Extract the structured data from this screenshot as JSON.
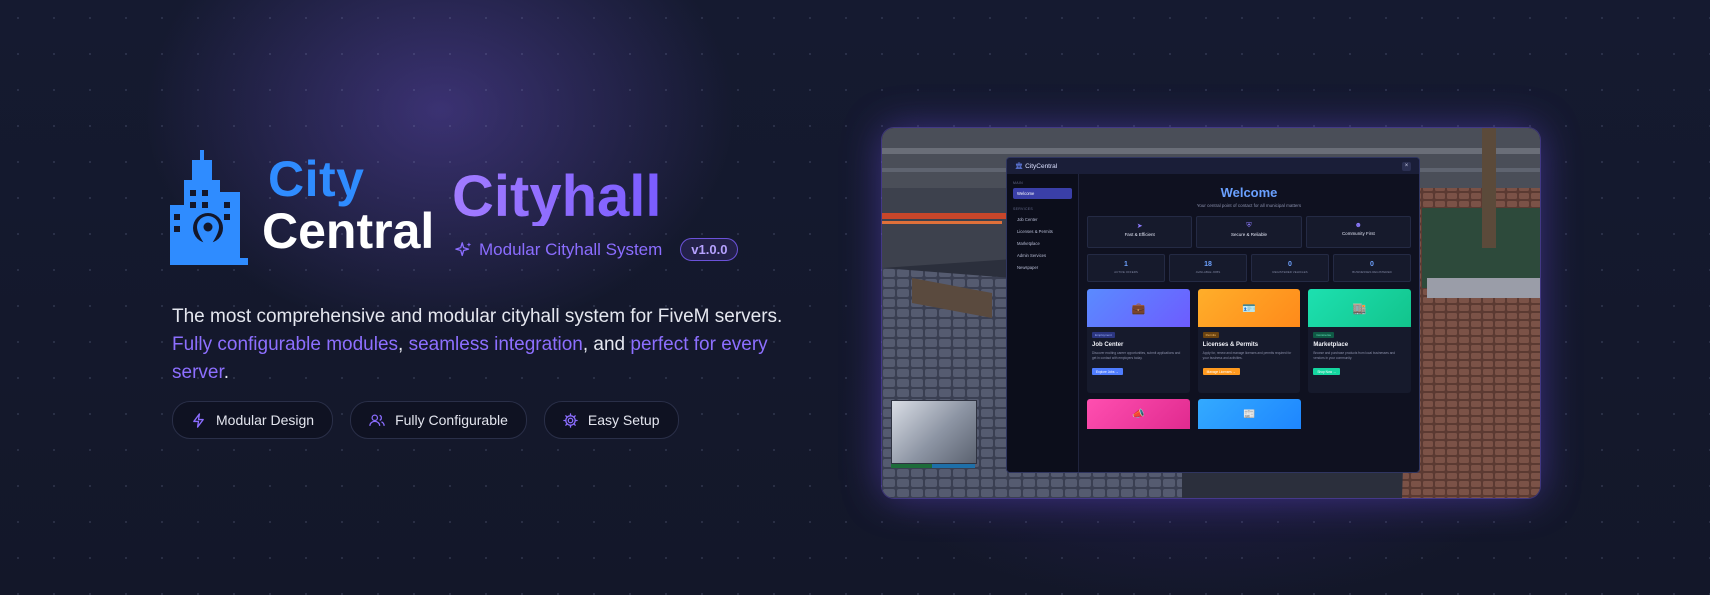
{
  "brand": {
    "logo_city": "City",
    "logo_central": "Central",
    "title": "Cityhall",
    "subtitle": "Modular Cityhall System",
    "version": "v1.0.0",
    "colors": {
      "accent_blue": "#2f8cff",
      "accent_purple": "#8b6dff",
      "background": "#13172b"
    }
  },
  "description": {
    "line_plain_1": "The most comprehensive and modular cityhall system for FiveM servers.",
    "hl_1": "Fully configurable modules",
    "sep_1": ", ",
    "hl_2": "seamless integration",
    "sep_2": ", and ",
    "hl_3": "perfect for every server",
    "end": "."
  },
  "features": [
    {
      "icon": "lightning-icon",
      "label": "Modular Design"
    },
    {
      "icon": "users-icon",
      "label": "Fully Configurable"
    },
    {
      "icon": "gear-icon",
      "label": "Easy Setup"
    }
  ],
  "preview": {
    "app_title": "CityCentral",
    "close_glyph": "×",
    "sidebar": {
      "section_main": "MAIN",
      "section_services": "SERVICES",
      "items": [
        "Welcome",
        "Job Center",
        "Licenses & Permits",
        "Marketplace",
        "Admin Services",
        "Newspaper"
      ]
    },
    "welcome_title": "Welcome",
    "welcome_sub": "Your central point of contact for all municipal matters",
    "feature_cards": [
      {
        "title": "Fast & Efficient"
      },
      {
        "title": "Secure & Reliable"
      },
      {
        "title": "Community First"
      }
    ],
    "stats": [
      {
        "value": "1",
        "label": "ACTIVE OFFERS"
      },
      {
        "value": "18",
        "label": "AVAILABLE JOBS"
      },
      {
        "value": "0",
        "label": "REGISTERED VEHICLES"
      },
      {
        "value": "0",
        "label": "BUSINESSES REGISTERED"
      }
    ],
    "service_cards": [
      {
        "tag": "Employment",
        "title": "Job Center",
        "desc": "Discover exciting career opportunities, submit applications and get in contact with employers today.",
        "button": "Explore Jobs →",
        "color": "#4f7dff"
      },
      {
        "tag": "Permits",
        "title": "Licenses & Permits",
        "desc": "Apply for, renew and manage licenses and permits required for your business and activities.",
        "button": "Manage Licenses →",
        "color": "#ff9a1f"
      },
      {
        "tag": "Commerce",
        "title": "Marketplace",
        "desc": "Browse and purchase products from local businesses and vendors in your community.",
        "button": "Shop Now →",
        "color": "#15d6a0"
      }
    ],
    "service_cards_row2": [
      {
        "color": "#ff3ca0"
      },
      {
        "color": "#1e9fff"
      }
    ]
  }
}
